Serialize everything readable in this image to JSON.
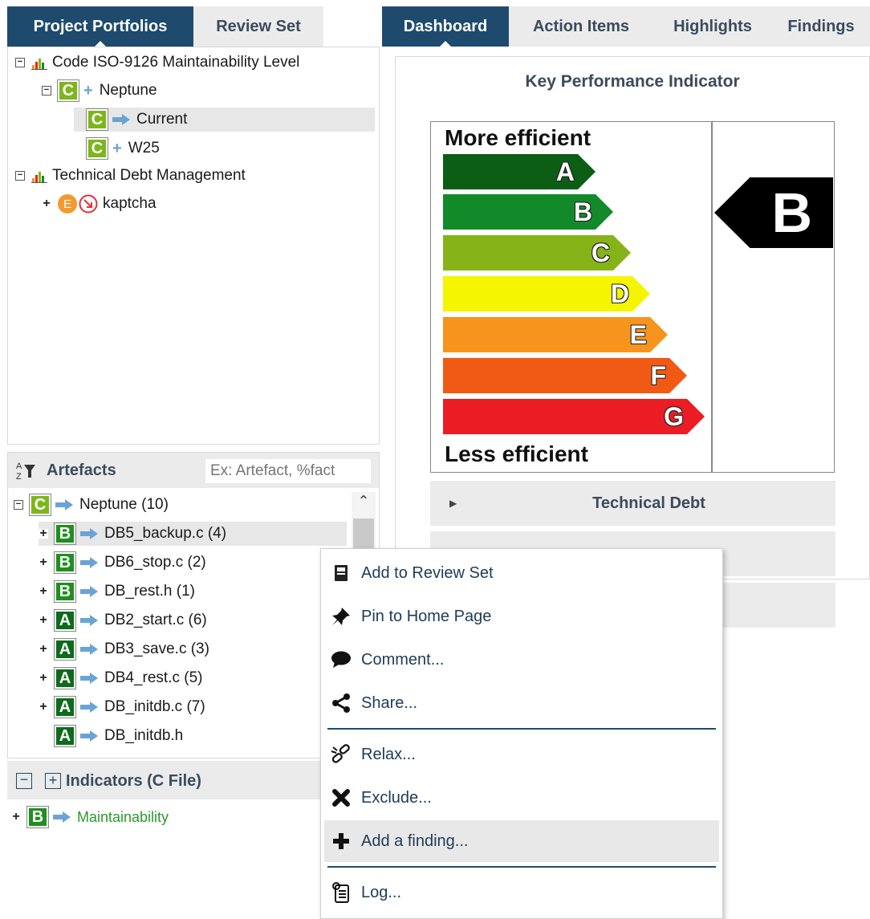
{
  "left_tabs": [
    "Project Portfolios",
    "Review Set"
  ],
  "right_tabs": [
    "Dashboard",
    "Action Items",
    "Highlights",
    "Findings"
  ],
  "portfolio_tree": [
    {
      "label": "Code ISO-9126 Maintainability Level"
    },
    {
      "label": "Neptune",
      "grade": "C"
    },
    {
      "label": "Current",
      "grade": "C"
    },
    {
      "label": "W25",
      "grade": "C"
    },
    {
      "label": "Technical Debt Management"
    },
    {
      "label": "kaptcha",
      "grade": "E"
    }
  ],
  "artefacts": {
    "title": "Artefacts",
    "search_placeholder": "Ex: Artefact, %fact",
    "root": {
      "label": "Neptune (10)",
      "grade": "C"
    },
    "items": [
      {
        "label": "DB5_backup.c (4)",
        "grade": "B"
      },
      {
        "label": "DB6_stop.c (2)",
        "grade": "B"
      },
      {
        "label": "DB_rest.h (1)",
        "grade": "B"
      },
      {
        "label": "DB2_start.c (6)",
        "grade": "A"
      },
      {
        "label": "DB3_save.c (3)",
        "grade": "A"
      },
      {
        "label": "DB4_rest.c (5)",
        "grade": "A"
      },
      {
        "label": "DB_initdb.c (7)",
        "grade": "A"
      },
      {
        "label": "DB_initdb.h",
        "grade": "A"
      }
    ]
  },
  "indicators": {
    "title": "Indicators (C File)",
    "items": [
      {
        "label": "Maintainability",
        "grade": "B"
      }
    ]
  },
  "kpi": {
    "title": "Key Performance Indicator",
    "top_label": "More efficient",
    "bottom_label": "Less efficient",
    "levels": [
      "A",
      "B",
      "C",
      "D",
      "E",
      "F",
      "G"
    ],
    "level_colors": [
      "#0b5e14",
      "#138a2a",
      "#86b418",
      "#f5f500",
      "#f7941d",
      "#f05a14",
      "#ec1c24"
    ],
    "current": "B"
  },
  "accordion": {
    "technical_debt": "Technical Debt"
  },
  "context_menu": {
    "items": [
      {
        "label": "Add to Review Set",
        "icon": "review-set-icon"
      },
      {
        "label": "Pin to Home Page",
        "icon": "pin-icon"
      },
      {
        "label": "Comment...",
        "icon": "comment-icon"
      },
      {
        "label": "Share...",
        "icon": "share-icon"
      },
      {
        "label": "Relax...",
        "icon": "relax-icon"
      },
      {
        "label": "Exclude...",
        "icon": "exclude-icon"
      },
      {
        "label": "Add a finding...",
        "icon": "add-icon"
      },
      {
        "label": "Log...",
        "icon": "log-icon"
      }
    ]
  },
  "colors": {
    "accent": "#1e4b6d",
    "tab_bg": "#ebebeb",
    "link_arrow": "#6aa3d6",
    "indicator_text": "#2a9a2a"
  }
}
